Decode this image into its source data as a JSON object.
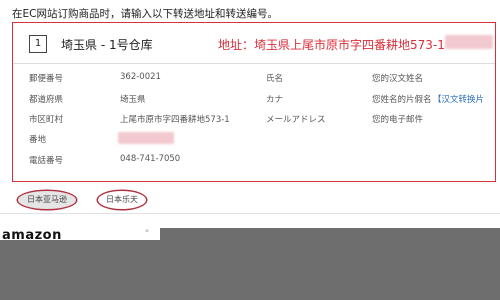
{
  "instruction": "在EC网站订购商品时，请输入以下转送地址和转送编号。",
  "warehouse": {
    "number": "1",
    "name": "埼玉県 - 1号仓库",
    "address_label": "地址：",
    "address_value": "埼玉県上尾市原市字四番耕地573-1"
  },
  "fields_left": [
    {
      "label": "郵便番号",
      "value": "362-0021"
    },
    {
      "label": "都道府県",
      "value": "埼玉県"
    },
    {
      "label": "市区町村",
      "value": "上尾市原市字四番耕地573-1"
    },
    {
      "label": "番地",
      "value": ""
    },
    {
      "label": "電話番号",
      "value": "048-741-7050"
    }
  ],
  "fields_right": [
    {
      "label": "氏名",
      "value": "您的汉文姓名"
    },
    {
      "label": "カナ",
      "value": "您姓名的片假名"
    },
    {
      "label": "メールアドレス",
      "value": "您的电子邮件"
    }
  ],
  "kana_link": "【汉文转换片",
  "tabs": [
    {
      "label": "日本亚马逊"
    },
    {
      "label": "日本乐天"
    }
  ],
  "amazon_logo": "amazon",
  "fragment": "\"",
  "colors": {
    "accent_red": "#d9303b",
    "link_blue": "#2b6fb5",
    "panel_gray": "#6e6e6e"
  }
}
